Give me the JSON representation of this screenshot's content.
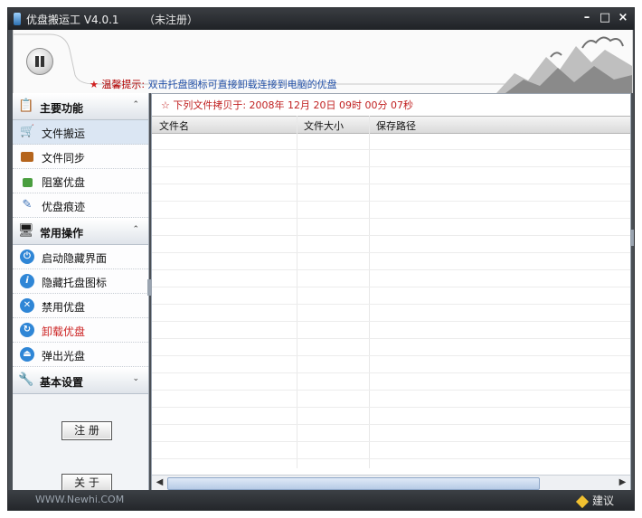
{
  "window": {
    "title": "优盘搬运工 V4.0.1",
    "title_status": "（未注册）",
    "minimize_glyph": "–",
    "maximize_glyph": "□",
    "close_glyph": "×"
  },
  "header": {
    "tip_label": "温馨提示:",
    "tip_message": "双击托盘图标可直接卸载连接到电脑的优盘"
  },
  "sidebar": {
    "groups": [
      {
        "title": "主要功能",
        "items": [
          {
            "label": "文件搬运",
            "icon": "cart-icon"
          },
          {
            "label": "文件同步",
            "icon": "briefcase-icon"
          },
          {
            "label": "阻塞优盘",
            "icon": "lock-icon"
          },
          {
            "label": "优盘痕迹",
            "icon": "broom-icon"
          }
        ]
      },
      {
        "title": "常用操作",
        "items": [
          {
            "label": "启动隐藏界面",
            "icon": "power-icon"
          },
          {
            "label": "隐藏托盘图标",
            "icon": "info-icon"
          },
          {
            "label": "禁用优盘",
            "icon": "disable-icon"
          },
          {
            "label": "卸载优盘",
            "icon": "refresh-icon"
          },
          {
            "label": "弹出光盘",
            "icon": "eject-icon"
          }
        ]
      },
      {
        "title": "基本设置",
        "items": []
      }
    ],
    "register_button": "注 册",
    "about_button": "关 于"
  },
  "content": {
    "copy_time_label": "☆ 下列文件拷贝于: 2008年 12月 20日 09时 00分 07秒",
    "columns": [
      "文件名",
      "文件大小",
      "保存路径"
    ],
    "rows": []
  },
  "statusbar": {
    "left_text": "WWW.Newhi.COM",
    "right_text": "建议"
  },
  "colors": {
    "title_bar": "#1f2226",
    "tip_red": "#b00000",
    "tip_blue": "#2250a8",
    "copy_line": "#c02020",
    "selected_item": "#dbe6f3"
  }
}
